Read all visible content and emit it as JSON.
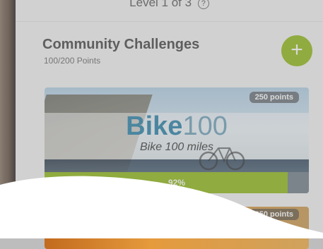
{
  "header": {
    "level_text": "Level 1 of 3",
    "help_icon": "question-circle-icon",
    "help_glyph": "?"
  },
  "section": {
    "title": "Community Challenges",
    "points": "100/200 Points",
    "add_icon": "plus-icon",
    "add_glyph": "+"
  },
  "challenges": [
    {
      "points_badge": "250 points",
      "title_bold": "Bike",
      "title_number": "100",
      "subtitle": "Bike 100 miles",
      "progress_label": "92%",
      "progress_fraction": 0.92
    },
    {
      "points_badge": "250 points"
    }
  ],
  "colors": {
    "accent_green": "#9abf2a",
    "title_blue": "#3b8db0"
  }
}
